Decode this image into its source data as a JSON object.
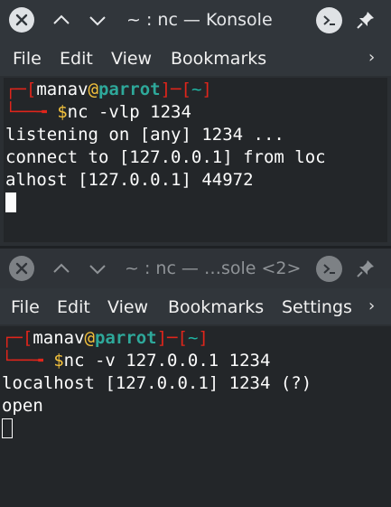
{
  "top_window": {
    "title": "~ : nc — Konsole",
    "menu": [
      "File",
      "Edit",
      "View",
      "Bookmarks"
    ],
    "more_symbol": "›",
    "prompt": {
      "open": "┌─[",
      "user": "manav",
      "at": "@",
      "host": "parrot",
      "mid": "]─[",
      "dir": "~",
      "close": "]",
      "arrow": "└──╼ ",
      "dollar": "$",
      "command": "nc -vlp 1234"
    },
    "output": [
      "listening on [any] 1234 ...",
      "connect to [127.0.0.1] from loc",
      "alhost [127.0.0.1] 44972"
    ]
  },
  "bottom_window": {
    "title": "~ : nc — …sole <2>",
    "menu": [
      "File",
      "Edit",
      "View",
      "Bookmarks",
      "Settings"
    ],
    "more_symbol": "›",
    "prompt": {
      "open": "┌─[",
      "user": "manav",
      "at": "@",
      "host": "parrot",
      "mid": "]─[",
      "dir": "~",
      "close": "]",
      "arrow": "└──╼ ",
      "dollar": "$",
      "command": "nc -v 127.0.0.1 1234"
    },
    "output": [
      "localhost [127.0.0.1] 1234 (?)",
      "open"
    ]
  }
}
